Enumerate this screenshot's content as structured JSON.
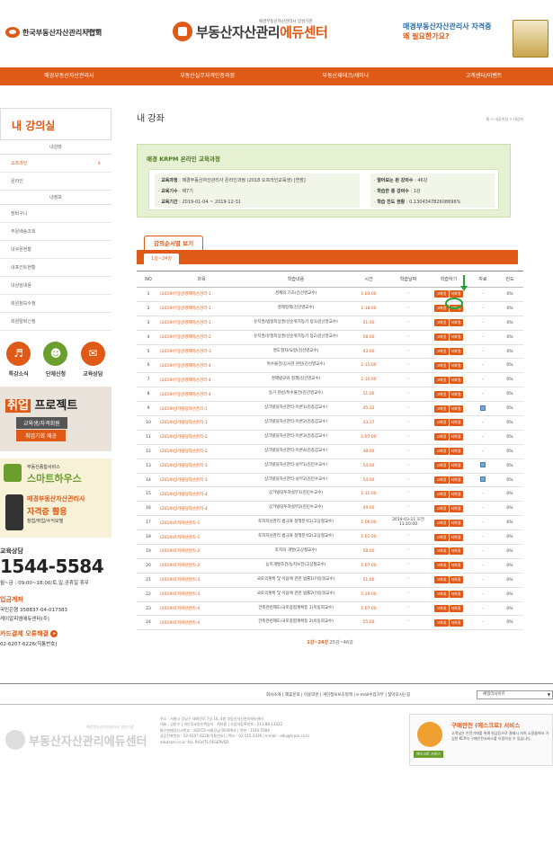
{
  "header": {
    "org_name": "한국부동산자산관리사협회",
    "org_abbr": "KRPMA",
    "center_sub": "매경부동산자산관리사 양성기관",
    "center_title": "부동산자산관리",
    "center_title_accent": "에듀센터",
    "banner_line1": "매경부동산자산관리사 자격증",
    "banner_line2": "왜 필요한가요?"
  },
  "nav": [
    "매경부동산자산관리사",
    "부동산실무자격인증과정",
    "부동산재테크/세미나",
    "고객센터/이벤트"
  ],
  "sidebar": {
    "title": "내 강의실",
    "group1": "내강좌",
    "items1": [
      {
        "label": "오프라인",
        "active": true
      },
      {
        "label": "온라인",
        "active": false
      }
    ],
    "group2": "내정보",
    "items2": [
      "장바구니",
      "주문배송조회",
      "내쿠폰현황",
      "내포인트현황",
      "내상담내용",
      "회원정보수정",
      "회원탈퇴신청"
    ],
    "icons": [
      {
        "label": "특강소식",
        "icon": "megaphone-icon"
      },
      {
        "label": "단체신청",
        "icon": "group-icon"
      },
      {
        "label": "교육상담",
        "icon": "chat-icon"
      }
    ],
    "banner1": {
      "head_a": "취업",
      "head_b": " 프로젝트",
      "line1": "교육생/자격회원",
      "line2": "취업기회 제공"
    },
    "banner2": {
      "small": "부동산종합서비스",
      "head": "스마트하우스",
      "line1": "매경부동산자산관리사",
      "line2": "자격증 활용",
      "line3": "창업/취업/수익모델"
    },
    "contact": {
      "label": "교육상담",
      "phone": "1544-5584",
      "hours": "월~금 : 09:00~18:00/토,일,공휴일 휴무",
      "bank_label": "입금계좌",
      "bank_info": "국민은행 358837-04-017383",
      "bank_owner": "케이알피엠에듀센터(주)",
      "card_label": "카드결제 오류해결",
      "card_phone": "02-6207-6226(직통번호)"
    }
  },
  "main": {
    "title": "내 강좌",
    "breadcrumb": "홈 > 내강의실 > 내강좌",
    "info_title": "매경 KRPM 온라인 교육과정",
    "info_left": [
      {
        "k": "교육과정",
        "v": " : 매경부동산자산관리사 온라인과정 (2018 오프라인교육생) [연장]"
      },
      {
        "k": "교육기수",
        "v": " : 제7기"
      },
      {
        "k": "교육기간",
        "v": " : 2019-01-04 ~ 2019-12-31"
      }
    ],
    "info_right": [
      {
        "k": "열어보는 된 강의수",
        "v": " : 46강"
      },
      {
        "k": "학습한 총 강의수",
        "v": " : 1강"
      },
      {
        "k": "학습 진도 현황",
        "v": " : 0.130434782608696%"
      }
    ],
    "tab_label": "강의순서별 보기",
    "page_tab": "1강~24강",
    "columns": [
      "NO",
      "과목",
      "학습내용",
      "시간",
      "학습날짜",
      "학습하기",
      "자료",
      "진도"
    ],
    "btn_a": "고화질",
    "btn_b": "저화질",
    "rows": [
      {
        "no": "1",
        "subject": "(2019)부동산경제자산관리-1",
        "content": "경제의 기초(김선영교수)",
        "time": "1:03:00",
        "date": "-",
        "progress": "0%",
        "file": false
      },
      {
        "no": "2",
        "subject": "(2019)부동산경제자산관리-1",
        "content": "경제정책(김선영교수)",
        "time": "1:18:00",
        "date": "-",
        "progress": "0%",
        "file": false
      },
      {
        "no": "3",
        "subject": "(2019)부동산경제자산관리-1",
        "content": "유치권/법정지상권/선순위가등기 등1(김선영교수)",
        "time": "51:00",
        "date": "-",
        "progress": "0%",
        "file": false
      },
      {
        "no": "4",
        "subject": "(2019)부동산경제자산관리-2",
        "content": "유치권/유정지상권/선순위가등기 등2(김선영교수)",
        "time": "58:00",
        "date": "-",
        "progress": "0%",
        "file": false
      },
      {
        "no": "5",
        "subject": "(2019)부동산경제자산관리-3",
        "content": "명도절차/요령(김선영교수)",
        "time": "43:00",
        "date": "-",
        "progress": "0%",
        "file": false
      },
      {
        "no": "6",
        "subject": "(2019)부동산경제자산관리-4",
        "content": "특수물건/공사관 관련(김선영교수)",
        "time": "1:15:00",
        "date": "-",
        "progress": "0%",
        "file": false
      },
      {
        "no": "7",
        "subject": "(2019)부동산경제자산관리-4",
        "content": "경매법규와 정책(김선영교수)",
        "time": "1:16:00",
        "date": "-",
        "progress": "0%",
        "file": false
      },
      {
        "no": "8",
        "subject": "(2019)부동산경제자산관리-4",
        "content": "등기 관련/특수물건(김선영교수)",
        "time": "51:00",
        "date": "-",
        "progress": "0%",
        "file": false
      },
      {
        "no": "9",
        "subject": "(2019)상가빌딩자산관리-1",
        "content": "상가빌딩자산관리-이론1(김종갑교수)",
        "time": "45:12",
        "date": "-",
        "progress": "0%",
        "file": true
      },
      {
        "no": "10",
        "subject": "(2019)상가빌딩자산관리-1",
        "content": "상가빌딩자산관리-이론2(김종갑교수)",
        "time": "43:37",
        "date": "-",
        "progress": "0%",
        "file": false
      },
      {
        "no": "11",
        "subject": "(2019)상가빌딩자산관리-2",
        "content": "상가빌딩자산관리-이론3(김종갑교수)",
        "time": "1:07:00",
        "date": "-",
        "progress": "0%",
        "file": false
      },
      {
        "no": "12",
        "subject": "(2019)상가빌딩자산관리-2",
        "content": "상가빌딩자산관리-이론4(김종갑교수)",
        "time": "48:00",
        "date": "-",
        "progress": "0%",
        "file": false
      },
      {
        "no": "13",
        "subject": "(2019)상가빌딩자산관리-3",
        "content": "상가빌딩자산관리-실무1(김민수교수)",
        "time": "54:00",
        "date": "-",
        "progress": "0%",
        "file": true
      },
      {
        "no": "14",
        "subject": "(2019)상가빌딩자산관리-3",
        "content": "상가빌딩자산관리-실무2(김민수교수)",
        "time": "54:00",
        "date": "-",
        "progress": "0%",
        "file": true
      },
      {
        "no": "15",
        "subject": "(2019)상가빌딩자산관리-4",
        "content": "상가빌딩투자실무1(김민수교수)",
        "time": "1:31:00",
        "date": "-",
        "progress": "0%",
        "file": false
      },
      {
        "no": "16",
        "subject": "(2019)상가빌딩자산관리-4",
        "content": "상가빌딩투자실무2(김민수교수)",
        "time": "49:00",
        "date": "-",
        "progress": "0%",
        "file": false
      },
      {
        "no": "17",
        "subject": "(2019)토지자산관리-1",
        "content": "토지자산관리 법규와 정책분석1(고상철교수)",
        "time": "1:06:00",
        "date": "2019-03-11 오전 11:10:00",
        "progress": "6%",
        "file": false
      },
      {
        "no": "18",
        "subject": "(2019)토지자산관리-1",
        "content": "토지자산관리 법규와 정책분석2(고상철교수)",
        "time": "1:01:00",
        "date": "-",
        "progress": "0%",
        "file": false
      },
      {
        "no": "19",
        "subject": "(2019)토지자산관리-2",
        "content": "토지의 개발(고상철교수)",
        "time": "58:00",
        "date": "-",
        "progress": "0%",
        "file": false
      },
      {
        "no": "20",
        "subject": "(2019)토지자산관리-2",
        "content": "농지개발조건/농지보전(고상철교수)",
        "time": "1:07:00",
        "date": "-",
        "progress": "0%",
        "file": false
      },
      {
        "no": "21",
        "subject": "(2019)토지자산관리-3",
        "content": "국토의계획 및 이용에 관한 법률1(이동희교수)",
        "time": "51:00",
        "date": "-",
        "progress": "0%",
        "file": false
      },
      {
        "no": "22",
        "subject": "(2019)토지자산관리-3",
        "content": "국토의계획 및 이용에 관한 법률2(이동희교수)",
        "time": "1:29:00",
        "date": "-",
        "progress": "0%",
        "file": false
      },
      {
        "no": "23",
        "subject": "(2019)토지자산관리-4",
        "content": "건축관련제도/국토종합계획등 1(이동희교수)",
        "time": "1:07:00",
        "date": "-",
        "progress": "0%",
        "file": false
      },
      {
        "no": "24",
        "subject": "(2019)토지자산관리-4",
        "content": "건축관련제도/국토종합계획등 2(이동희교수)",
        "time": "55:00",
        "date": "-",
        "progress": "0%",
        "file": false
      }
    ],
    "pager_a": "1강~24강",
    "pager_b": " 25강~46강"
  },
  "footer": {
    "links": "회사소개 | 제휴문의 | 이용약관 | 개인정보보호정책 | e-mail수집거부 | 찾아오시는길",
    "family": "패밀리사이트",
    "logo": "부동산자산관리에듀센터",
    "logo_sub": "매경부동산자산관리사 양성기관",
    "addr1": "주소 : 서울시 강남구 테헤란로 7길 16, 4층 부동산자산관리에듀센터",
    "addr2": "대표 : 김만수 | 개인정보관리책임자 : 최아름 | 사업자등록번호 : 211-88-13322",
    "addr3": "통신판매업신고번호 : 제2015-서울강남-00499호 | 전화 : 1544-5584",
    "addr4": "상담전화번호 : 02-6207-6226(직통번호) | 팩스 : 02-515-2436 | e-mail : edu@krpm.co.kr",
    "addr5": "edukrpm.co.kr ALL RIGHTS RESERVED.",
    "escrow_title": "구매안전 (에스크로) 서비스",
    "escrow_text": "고객님은 안전거래를 위해 현금등으로 결제시 저희 쇼핑몰에서 가입한 KCP의 구매안전서비스를 이용하실 수 있습니다.",
    "escrow_tag": "에스크로 서비스"
  }
}
